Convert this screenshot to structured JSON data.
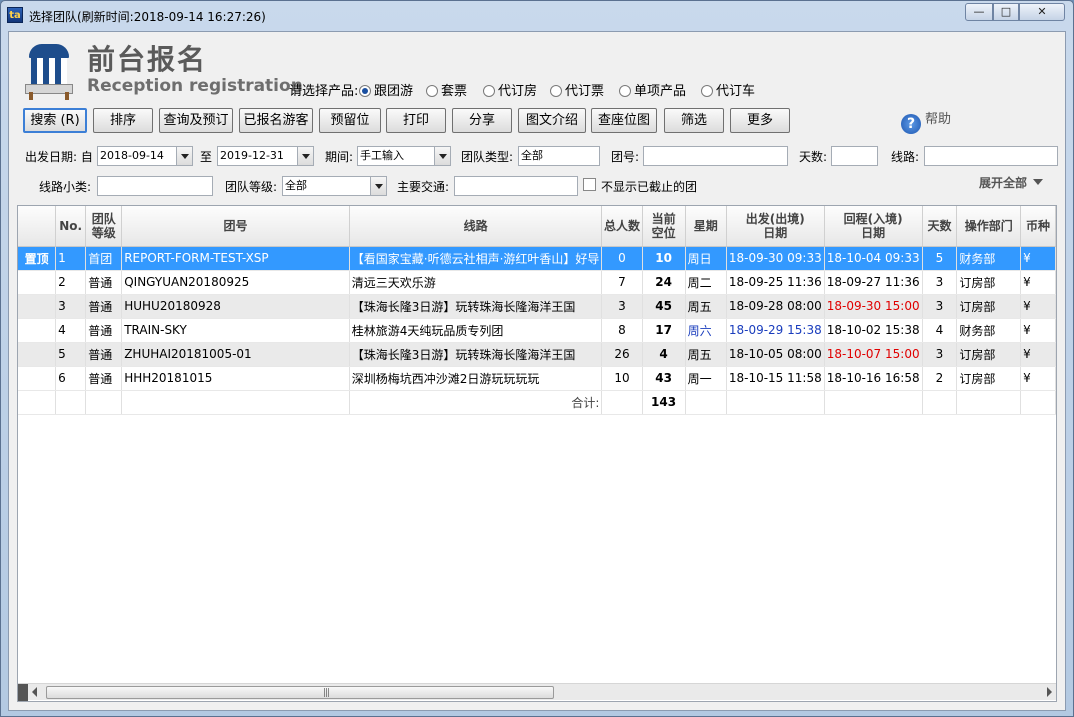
{
  "window": {
    "title": "选择团队(刷新时间:2018-09-14   16:27:26)",
    "min_label": "—",
    "max_label": "□",
    "close_label": "✕"
  },
  "header": {
    "title": "前台报名",
    "subtitle": "Reception registration",
    "product_label": "请选择产品:",
    "products": [
      {
        "label": "跟团游",
        "selected": true
      },
      {
        "label": "套票",
        "selected": false
      },
      {
        "label": "代订房",
        "selected": false
      },
      {
        "label": "代订票",
        "selected": false
      },
      {
        "label": "单项产品",
        "selected": false
      },
      {
        "label": "代订车",
        "selected": false
      }
    ]
  },
  "toolbar": {
    "search": "搜索 (R)",
    "sort": "排序",
    "query": "查询及预订",
    "registered": "已报名游客",
    "reserve": "预留位",
    "print": "打印",
    "share": "分享",
    "intro": "图文介绍",
    "seatmap": "查座位图",
    "filter": "筛选",
    "more": "更多",
    "help": "帮助"
  },
  "filters": {
    "date_label": "出发日期: 自",
    "date_from": "2018-09-14",
    "to_label": "至",
    "date_to": "2019-12-31",
    "period_label": "期间:",
    "period_value": "手工输入",
    "team_type_label": "团队类型:",
    "team_type_value": "全部",
    "team_no_label": "团号:",
    "team_no_value": "",
    "days_label": "天数:",
    "days_value": "",
    "route_label": "线路:",
    "route_value": "",
    "route_sub_label": "线路小类:",
    "route_sub_value": "",
    "team_level_label": "团队等级:",
    "team_level_value": "全部",
    "transport_label": "主要交通:",
    "transport_value": "",
    "hide_closed_label": "不显示已截止的团",
    "expand_all": "展开全部"
  },
  "table": {
    "headers": {
      "no": "No.",
      "level": "团队\n等级",
      "team_no": "团号",
      "route": "线路",
      "total": "总人数",
      "vacancy": "当前\n空位",
      "weekday": "星期",
      "depart": "出发(出境)\n日期",
      "return": "回程(入境)\n日期",
      "days": "天数",
      "dept": "操作部门",
      "currency": "币种"
    },
    "rows": [
      {
        "pin": "置顶",
        "no": "1",
        "level": "首团",
        "team_no": "REPORT-FORM-TEST-XSP",
        "route": "【看国家宝藏·听德云社相声·游红叶香山】好导",
        "total": "0",
        "vacancy": "10",
        "weekday": "周日",
        "depart": "18-09-30 09:33",
        "return": "18-10-04 09:33",
        "days": "5",
        "dept": "财务部",
        "currency": "¥"
      },
      {
        "pin": "",
        "no": "2",
        "level": "普通",
        "team_no": "QINGYUAN20180925",
        "route": "清远三天欢乐游",
        "total": "7",
        "vacancy": "24",
        "weekday": "周二",
        "depart": "18-09-25 11:36",
        "return": "18-09-27 11:36",
        "days": "3",
        "dept": "订房部",
        "currency": "¥"
      },
      {
        "pin": "",
        "no": "3",
        "level": "普通",
        "team_no": "HUHU20180928",
        "route": "【珠海长隆3日游】玩转珠海长隆海洋王国",
        "total": "3",
        "vacancy": "45",
        "weekday": "周五",
        "depart": "18-09-28 08:00",
        "return": "18-09-30 15:00",
        "days": "3",
        "dept": "订房部",
        "currency": "¥"
      },
      {
        "pin": "",
        "no": "4",
        "level": "普通",
        "team_no": "TRAIN-SKY",
        "route": "桂林旅游4天纯玩品质专列团",
        "total": "8",
        "vacancy": "17",
        "weekday": "周六",
        "depart": "18-09-29 15:38",
        "return": "18-10-02 15:38",
        "days": "4",
        "dept": "财务部",
        "currency": "¥"
      },
      {
        "pin": "",
        "no": "5",
        "level": "普通",
        "team_no": "ZHUHAI20181005-01",
        "route": "【珠海长隆3日游】玩转珠海长隆海洋王国",
        "total": "26",
        "vacancy": "4",
        "weekday": "周五",
        "depart": "18-10-05 08:00",
        "return": "18-10-07 15:00",
        "days": "3",
        "dept": "订房部",
        "currency": "¥"
      },
      {
        "pin": "",
        "no": "6",
        "level": "普通",
        "team_no": "HHH20181015",
        "route": "深圳杨梅坑西冲沙滩2日游玩玩玩玩",
        "total": "10",
        "vacancy": "43",
        "weekday": "周一",
        "depart": "18-10-15 11:58",
        "return": "18-10-16 16:58",
        "days": "2",
        "dept": "订房部",
        "currency": "¥"
      }
    ],
    "sum_label": "合计:",
    "sum_vacancy": "143"
  },
  "scrollbar": {
    "grip": "|||"
  }
}
